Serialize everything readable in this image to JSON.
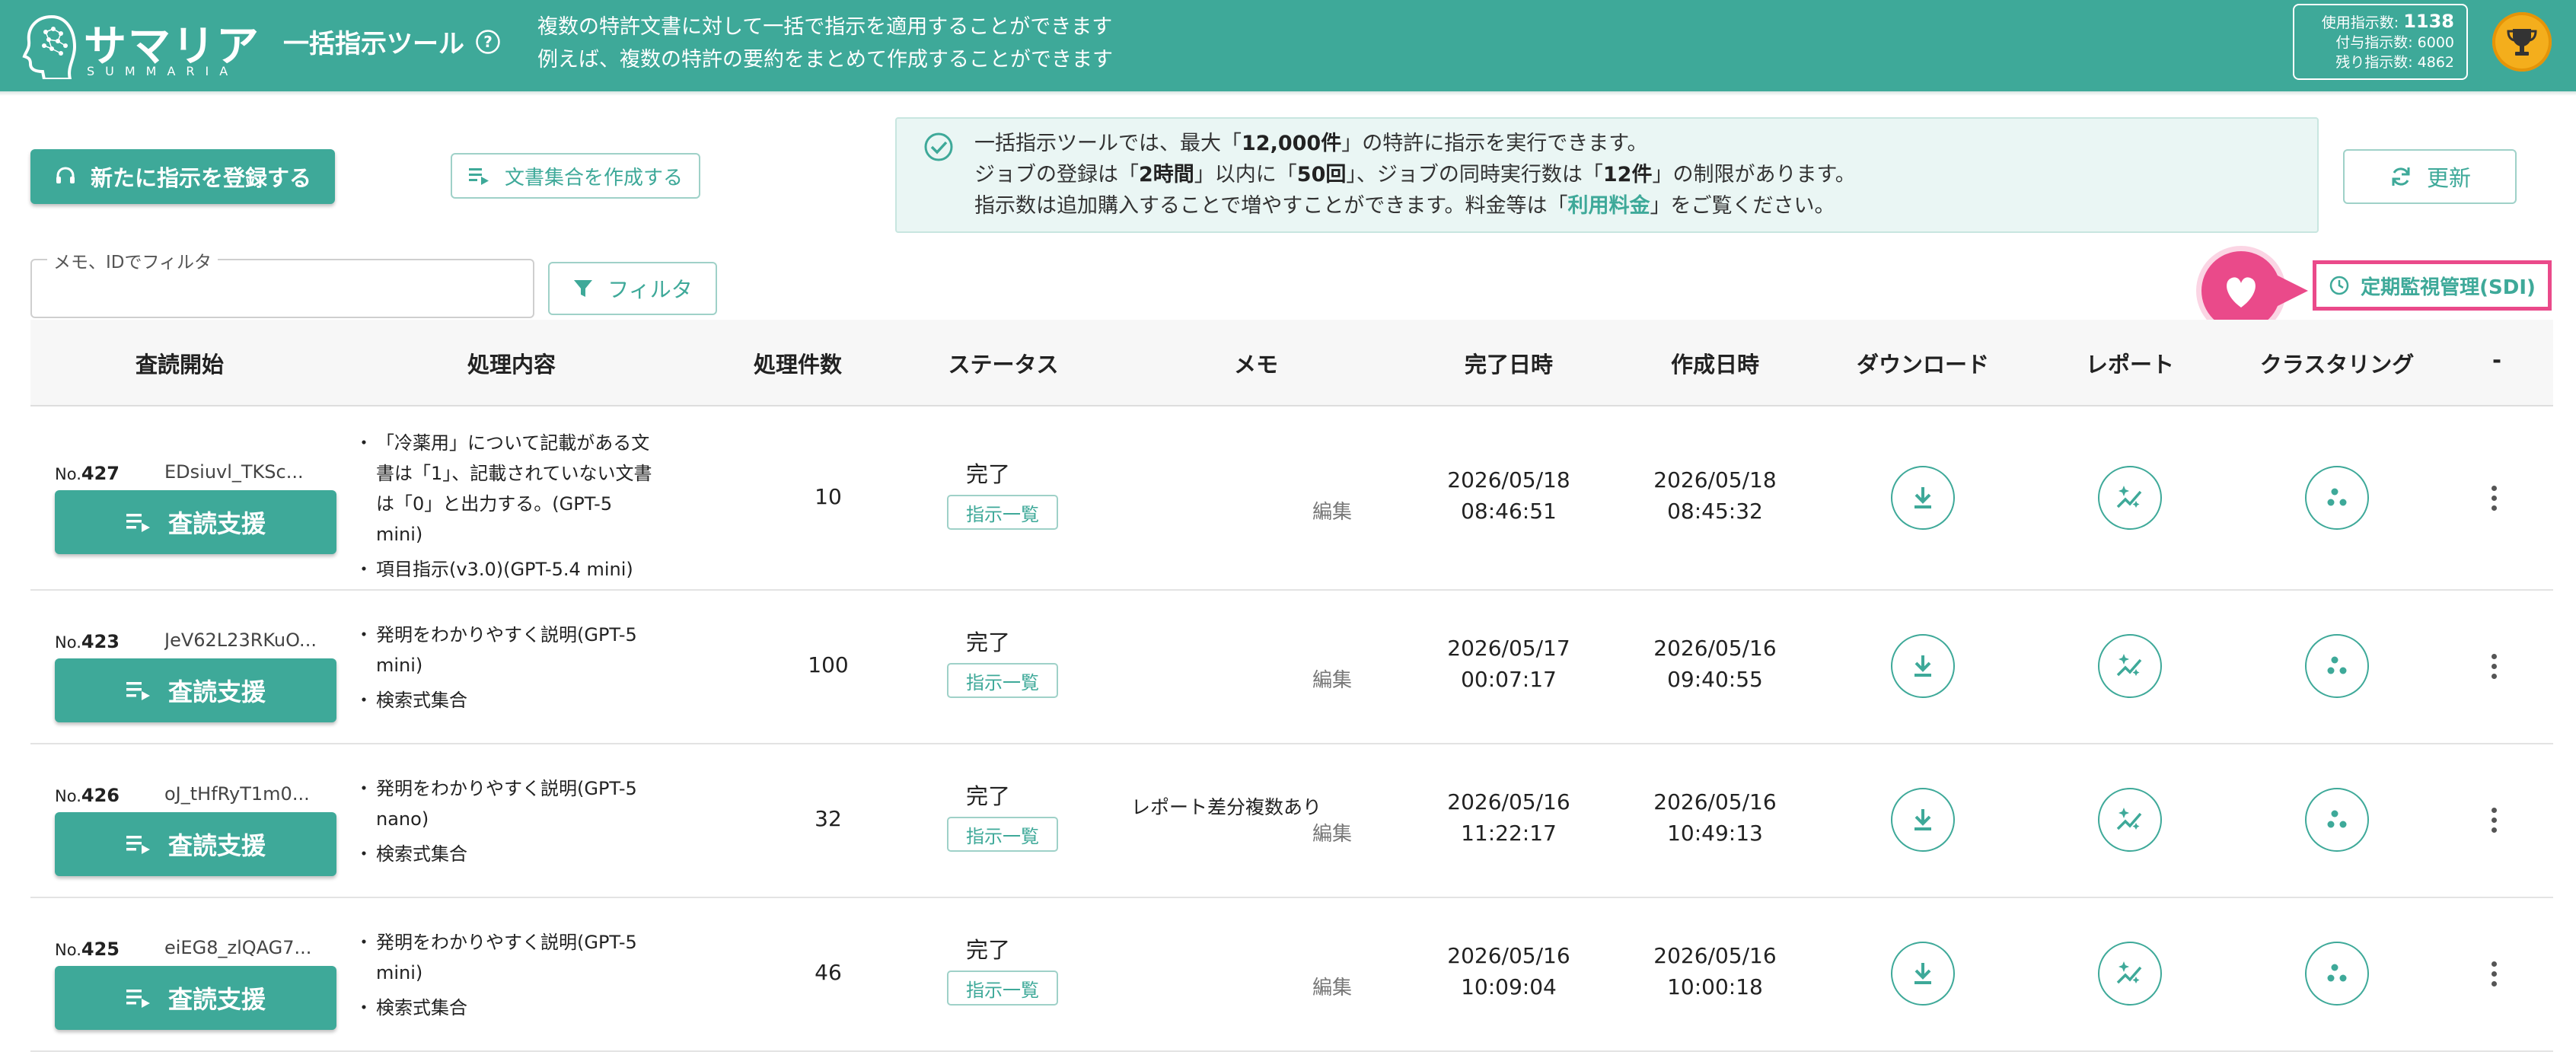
{
  "header": {
    "logo_name": "サマリア",
    "logo_sub": "SUMMARIA",
    "tool_title": "一括指示ツール",
    "description": [
      "複数の特許文書に対して一括で指示を適用することができます",
      "例えば、複数の特許の要約をまとめて作成することができます"
    ],
    "usage": {
      "used_label": "使用指示数:",
      "used_value": "1138",
      "granted_label": "付与指示数:",
      "granted_value": "6000",
      "remaining_label": "残り指示数:",
      "remaining_value": "4862"
    }
  },
  "toolbar": {
    "new_button": "新たに指示を登録する",
    "doc_set_button": "文書集合を作成する",
    "refresh_button": "更新",
    "filter_label": "メモ、IDでフィルタ",
    "filter_value": "",
    "filter_button": "フィルタ",
    "sdi_button": "定期監視管理(SDI)"
  },
  "info": {
    "l1_a": "一括指示ツールでは、最大「",
    "l1_b": "12,000件",
    "l1_c": "」の特許に指示を実行できます。",
    "l2_a": "ジョブの登録は「",
    "l2_b": "2時間",
    "l2_c": "」以内に「",
    "l2_d": "50回",
    "l2_e": "」、ジョブの同時実行数は「",
    "l2_f": "12件",
    "l2_g": "」の制限があります。",
    "l3_a": "指示数は追加購入することで増やすことができます。料金等は「",
    "l3_link": "利用料金",
    "l3_b": "」をご覧ください。"
  },
  "table": {
    "headers": [
      "査読開始",
      "処理内容",
      "処理件数",
      "ステータス",
      "メモ",
      "完了日時",
      "作成日時",
      "ダウンロード",
      "レポート",
      "クラスタリング",
      "-"
    ],
    "row_button": "査読支援",
    "list_button": "指示一覧",
    "edit_label": "編集",
    "rows": [
      {
        "no_prefix": "No.",
        "no": "427",
        "id": "EDsiuvl_TKSc...",
        "proc": [
          "「冷薬用」について記載がある文書は「1」、記載されていない文書は「0」と出力する。(GPT-5 mini)",
          "項目指示(v3.0)(GPT-5.4 mini)"
        ],
        "count": "10",
        "status": "完了",
        "memo": "",
        "completed": [
          "2026/05/18",
          "08:46:51"
        ],
        "created": [
          "2026/05/18",
          "08:45:32"
        ]
      },
      {
        "no_prefix": "No.",
        "no": "423",
        "id": "JeV62L23RKuO...",
        "proc": [
          "発明をわかりやすく説明(GPT-5 mini)",
          "検索式集合"
        ],
        "count": "100",
        "status": "完了",
        "memo": "",
        "completed": [
          "2026/05/17",
          "00:07:17"
        ],
        "created": [
          "2026/05/16",
          "09:40:55"
        ]
      },
      {
        "no_prefix": "No.",
        "no": "426",
        "id": "oJ_tHfRyT1m0...",
        "proc": [
          "発明をわかりやすく説明(GPT-5 nano)",
          "検索式集合"
        ],
        "count": "32",
        "status": "完了",
        "memo": "レポート差分複数あり",
        "completed": [
          "2026/05/16",
          "11:22:17"
        ],
        "created": [
          "2026/05/16",
          "10:49:13"
        ]
      },
      {
        "no_prefix": "No.",
        "no": "425",
        "id": "eiEG8_zlQAG7...",
        "proc": [
          "発明をわかりやすく説明(GPT-5 mini)",
          "検索式集合"
        ],
        "count": "46",
        "status": "完了",
        "memo": "",
        "completed": [
          "2026/05/16",
          "10:09:04"
        ],
        "created": [
          "2026/05/16",
          "10:00:18"
        ]
      }
    ]
  },
  "colors": {
    "accent": "#3ea999",
    "highlight": "#ea4a8a",
    "trophy": "#f4ae1c"
  }
}
